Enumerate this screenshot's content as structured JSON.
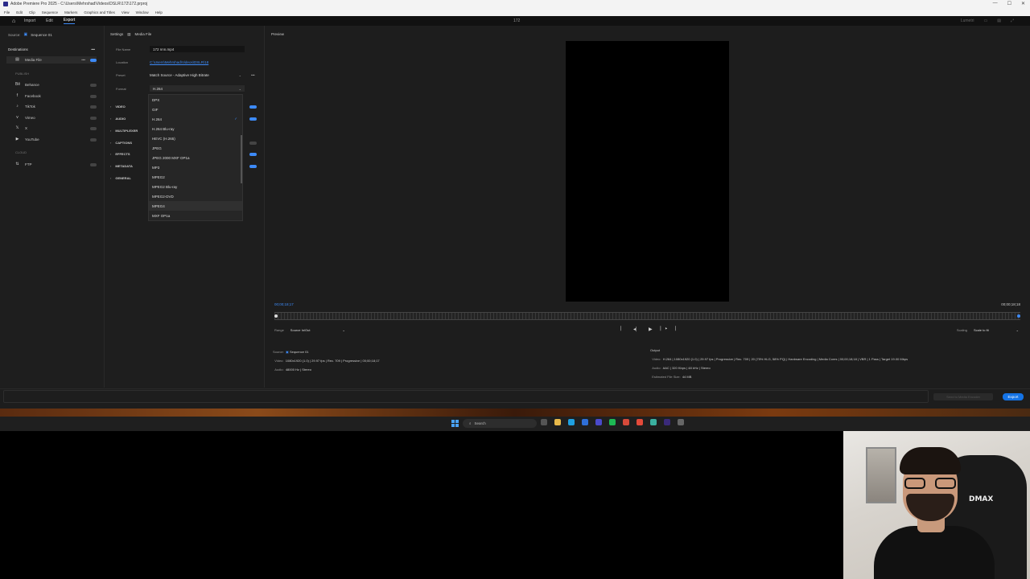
{
  "window": {
    "title": "Adobe Premiere Pro 2025 - C:\\Users\\Mehrshad\\Videos\\DSLR\\172\\172.prproj",
    "controls": [
      "—",
      "☐",
      "✕"
    ]
  },
  "menubar": [
    "File",
    "Edit",
    "Clip",
    "Sequence",
    "Markers",
    "Graphics and Titles",
    "View",
    "Window",
    "Help"
  ],
  "modebar": {
    "tabs": [
      "Import",
      "Edit",
      "Export"
    ],
    "active_tab": "Export",
    "project_title": "172",
    "right_label": "Lumetri"
  },
  "left_panel": {
    "source_label": "Source:",
    "source_value": "Sequence 01",
    "destinations_label": "Destinations",
    "destinations_more": "•••",
    "media_file": "Media File",
    "publish_group": "PUBLISH",
    "publish_items": [
      "Behance",
      "Facebook",
      "TikTok",
      "Vimeo",
      "X",
      "YouTube"
    ],
    "cloud_group": "CLOUD",
    "cloud_items": [
      "FTP"
    ]
  },
  "settings": {
    "tab_settings": "Settings",
    "tab_media": "Media File",
    "file_name_label": "File Name",
    "file_name_value": "172 nnn.mp4",
    "location_label": "Location",
    "location_value": "C:\\Users\\Mehrshad\\Videos\\DSLR\\18",
    "preset_label": "Preset",
    "preset_value": "Match Source - Adaptive High Bitrate",
    "preset_more": "•••",
    "format_label": "Format",
    "format_value": "H.264",
    "sections": [
      "VIDEO",
      "AUDIO",
      "MULTIPLEXER",
      "CAPTIONS",
      "EFFECTS",
      "METADATA",
      "GENERAL"
    ]
  },
  "format_dropdown": {
    "options": [
      "DPX",
      "GIF",
      "H.264",
      "H.264 Blu-ray",
      "HEVC (H.265)",
      "JPEG",
      "JPEG 2000 MXF OP1a",
      "MP3",
      "MPEG2",
      "MPEG2 Blu-ray",
      "MPEG2-DVD",
      "MPEG4",
      "MXF OP1a"
    ],
    "selected": "H.264",
    "check": "✓"
  },
  "preview": {
    "label": "Preview",
    "timecode_in": "00;00;18;17",
    "timecode_out": "00;00;18;18",
    "range_label": "Range",
    "range_value": "Source In/Out",
    "scaling_label": "Scaling",
    "scaling_value": "Scale to fit",
    "transport": [
      "⎸",
      "◂⎸",
      "▶",
      "⎸▸",
      "⎸"
    ]
  },
  "source_info": {
    "label": "Source:",
    "name": "Sequence 01",
    "video_label": "Video:",
    "video_value": "1080x1920 (1.0)  |  29.97 fps  |  Rec. 709  |  Progressive  |  00;00;18;17",
    "audio_label": "Audio:",
    "audio_value": "48000 Hz  |  Stereo"
  },
  "output_info": {
    "label": "Output",
    "video_label": "Video:",
    "video_value": "H.264  |  1080x1920 (1.0)  |  29.97 fps  |  Progressive  |  Rec. 709  |  20 (75% HLG, 58% PQ)  |  Hardware Encoding  |  Media Cores  |  00;00;18;18  |  VBR  |  1 Pass  |  Target 19.00 Mbps",
    "audio_label": "Audio:",
    "audio_value": "AAC  |  320 Kbps  |  48 kHz  |  Stereo",
    "size_label": "Estimated File Size:",
    "size_value": "44 MB"
  },
  "footer": {
    "queue_label": "Send to Media Encoder",
    "export_label": "Export"
  },
  "taskbar": {
    "search_placeholder": "Search"
  },
  "webcam": {
    "chair_text": "DMAX"
  },
  "colors": {
    "accent": "#3d8af7",
    "export_button": "#1473e6"
  }
}
